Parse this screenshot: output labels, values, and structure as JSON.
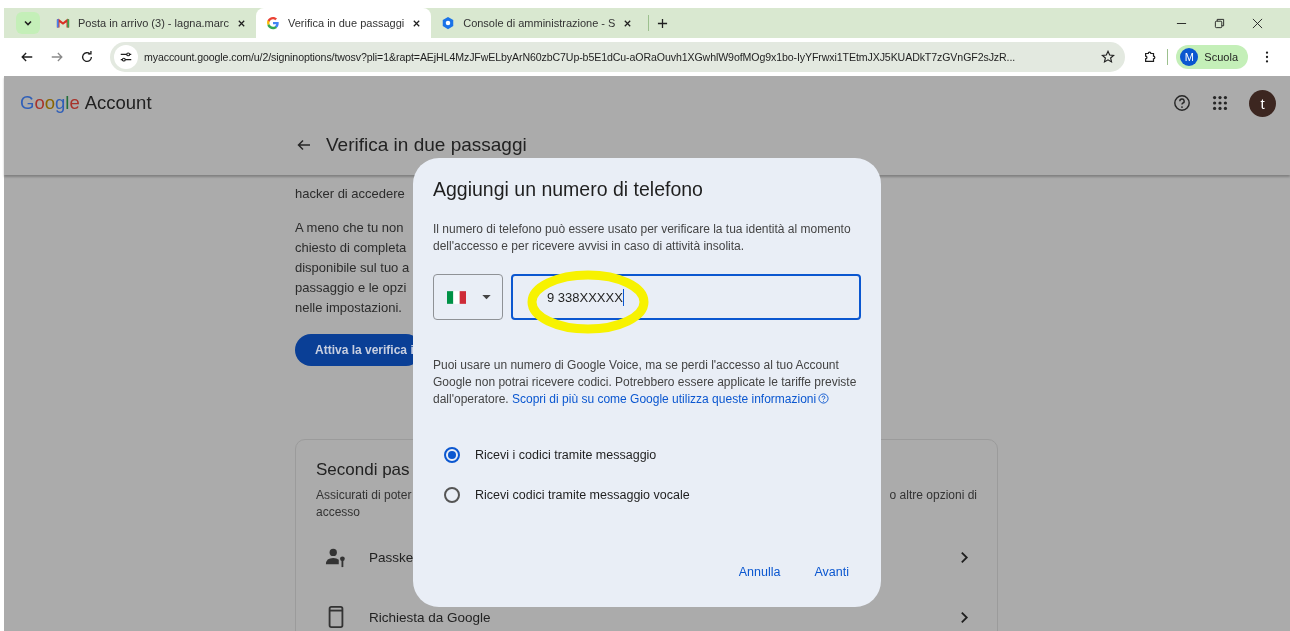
{
  "browser": {
    "tabs": [
      {
        "kind": "mail",
        "title": "Posta in arrivo (3) - lagna.marc",
        "selected": false
      },
      {
        "kind": "google",
        "title": "Verifica in due passaggi",
        "selected": true
      },
      {
        "kind": "admin",
        "title": "Console di amministrazione - S",
        "selected": false
      }
    ],
    "url": "myaccount.google.com/u/2/signinoptions/twosv?pli=1&rapt=AEjHL4MzJFwELbyArN60zbC7Up-b5E1dCu-aORaOuvh1XGwhlW9ofMOg9x1bo-IyYFrwxi1TEtmJXJ5KUADkT7zGVnGF2sJzR...",
    "profile": {
      "initial": "M",
      "label": "Scuola"
    }
  },
  "header": {
    "logo": "Google",
    "product": "Account",
    "avatar_initial": "t"
  },
  "page": {
    "title": "Verifica in due passaggi",
    "lines_1": [
      "hacker di accedere"
    ],
    "lines_2": [
      "A meno che tu non",
      "chiesto di completa",
      "disponibile sul tuo a",
      "passaggio e le opzi",
      "nelle impostazioni."
    ],
    "button": "Attiva la verifica i",
    "card": {
      "title": "Secondi pas",
      "subtitle_left": "Assicurati di poter",
      "subtitle_right": "o altre opzioni di",
      "subtitle_line2": "accesso",
      "rows": [
        {
          "kind": "passkey",
          "label": "Passke"
        },
        {
          "kind": "prompt",
          "label": "Richiesta da Google"
        }
      ]
    }
  },
  "dialog": {
    "title": "Aggiungi un numero di telefono",
    "intro": "Il numero di telefono può essere usato per verificare la tua identità al momento dell'accesso e per ricevere avvisi in caso di attività insolita.",
    "phone": "9 338XXXXX",
    "note": "Puoi usare un numero di Google Voice, ma se perdi l'accesso al tuo Account Google non potrai ricevere codici. Potrebbero essere applicate le tariffe previste dall'operatore.",
    "link": "Scopri di più su come Google utilizza queste informazioni",
    "options": [
      {
        "label": "Ricevi i codici tramite messaggio",
        "selected": true
      },
      {
        "label": "Ricevi codici tramite messaggio vocale",
        "selected": false
      }
    ],
    "buttons": [
      "Annulla",
      "Avanti"
    ]
  }
}
